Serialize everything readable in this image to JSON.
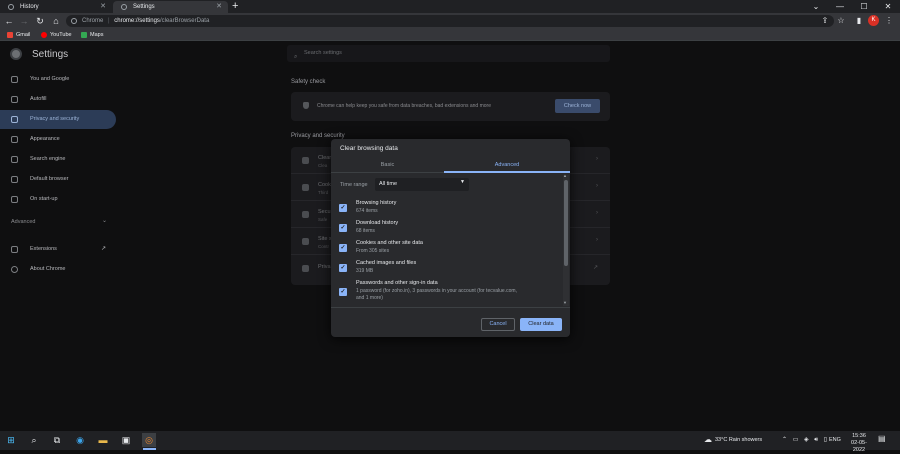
{
  "browser": {
    "tabs": [
      {
        "label": "History"
      },
      {
        "label": "Settings"
      }
    ],
    "new_tab": "+",
    "window_controls": [
      "⌄",
      "—",
      "☐",
      "✕"
    ],
    "address": {
      "host": "chrome://settings",
      "path": "/clearBrowserData",
      "scheme_label": "Chrome"
    },
    "bookmarks": [
      {
        "label": "Gmail",
        "color": "#ea4335"
      },
      {
        "label": "YouTube",
        "color": "#ff0000"
      },
      {
        "label": "Maps",
        "color": "#34a853"
      }
    ],
    "avatar_letter": "K"
  },
  "settings": {
    "title": "Settings",
    "search_placeholder": "Search settings",
    "sidebar": [
      {
        "label": "You and Google"
      },
      {
        "label": "Autofill"
      },
      {
        "label": "Privacy and security",
        "active": true
      },
      {
        "label": "Appearance"
      },
      {
        "label": "Search engine"
      },
      {
        "label": "Default browser"
      },
      {
        "label": "On start-up"
      }
    ],
    "advanced_label": "Advanced",
    "sidebar_extra": [
      {
        "label": "Extensions"
      },
      {
        "label": "About Chrome"
      }
    ],
    "safety_check": {
      "heading": "Safety check",
      "text": "Chrome can help keep you safe from data breaches, bad extensions and more",
      "button": "Check now"
    },
    "privacy": {
      "heading": "Privacy and security",
      "rows": [
        {
          "title": "Clear",
          "sub": "Clea"
        },
        {
          "title": "Cooki",
          "sub": "Third"
        },
        {
          "title": "Secu",
          "sub": "Safe"
        },
        {
          "title": "Site s",
          "sub": "Contr"
        },
        {
          "title": "Priva",
          "sub": ""
        }
      ]
    }
  },
  "dialog": {
    "title": "Clear browsing data",
    "tabs": {
      "basic": "Basic",
      "advanced": "Advanced"
    },
    "time_range_label": "Time range",
    "time_range_value": "All time",
    "items": [
      {
        "title": "Browsing history",
        "sub": "674 items",
        "checked": true
      },
      {
        "title": "Download history",
        "sub": "68 items",
        "checked": true
      },
      {
        "title": "Cookies and other site data",
        "sub": "From 305 sites",
        "checked": true
      },
      {
        "title": "Cached images and files",
        "sub": "319 MB",
        "checked": true
      },
      {
        "title": "Passwords and other sign-in data",
        "sub": "1 password (for zoho.in), 3 passwords in your account (for tecvalue.com, and 1 more)",
        "checked": true
      }
    ],
    "cancel": "Cancel",
    "confirm": "Clear data"
  },
  "taskbar": {
    "weather": "33°C  Rain showers",
    "language": "ENG",
    "time": "15:36",
    "date": "02-05-2022"
  }
}
